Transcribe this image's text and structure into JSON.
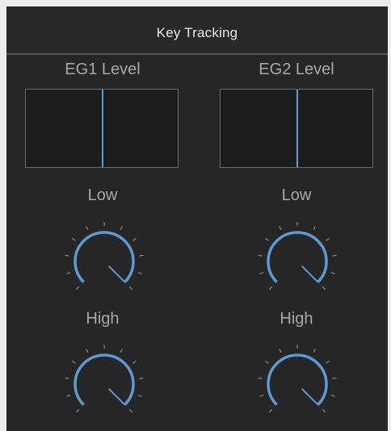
{
  "panel": {
    "title": "Key Tracking"
  },
  "eg1": {
    "label": "EG1 Level",
    "level": 0.5,
    "low_label": "Low",
    "high_label": "High"
  },
  "eg2": {
    "label": "EG2 Level",
    "level": 0.5,
    "low_label": "Low",
    "high_label": "High"
  },
  "knob_value_fraction": 1.0,
  "colors": {
    "background": "#262626",
    "accent": "#5b9bd5",
    "text": "#a8a8a8",
    "title": "#e8e8e8",
    "tick": "#8a8a8a"
  }
}
